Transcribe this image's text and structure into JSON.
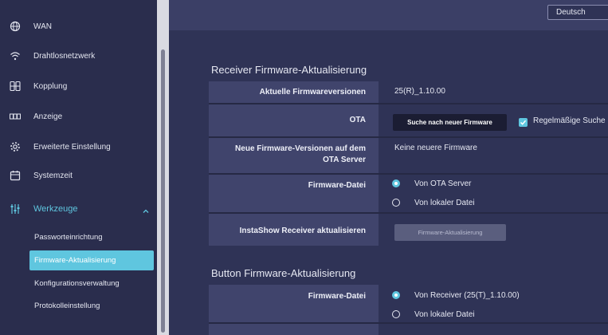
{
  "sidebar": {
    "items": [
      {
        "label": "WAN",
        "icon": "globe-icon"
      },
      {
        "label": "Drahtlosnetzwerk",
        "icon": "wifi-icon"
      },
      {
        "label": "Kopplung",
        "icon": "pairing-icon"
      },
      {
        "label": "Anzeige",
        "icon": "display-icon"
      },
      {
        "label": "Erweiterte Einstellung",
        "icon": "gear-icon"
      },
      {
        "label": "Systemzeit",
        "icon": "calendar-icon"
      },
      {
        "label": "Werkzeuge",
        "icon": "tools-icon"
      }
    ],
    "subitems": [
      {
        "label": "Passworteinrichtung"
      },
      {
        "label": "Firmware-Aktualisierung"
      },
      {
        "label": "Konfigurationsverwaltung"
      },
      {
        "label": "Protokolleinstellung"
      }
    ]
  },
  "header": {
    "language": "Deutsch"
  },
  "receiver": {
    "title": "Receiver Firmware-Aktualisierung",
    "current_label": "Aktuelle Firmwareversionen",
    "current_value": "25(R)_1.10.00",
    "ota_label": "OTA",
    "ota_button": "Suche nach neuer Firmware",
    "ota_checkbox": "Regelmäßige Suche",
    "new_label_line1": "Neue Firmware-Versionen auf dem",
    "new_label_line2": "OTA Server",
    "new_value": "Keine neuere Firmware",
    "file_label": "Firmware-Datei",
    "file_option1": "Von OTA Server",
    "file_option2": "Von lokaler Datei",
    "update_label": "InstaShow Receiver aktualisieren",
    "update_button": "Firmware-Aktualisierung"
  },
  "button_section": {
    "title": "Button Firmware-Aktualisierung",
    "file_label": "Firmware-Datei",
    "file_option1": "Von Receiver (25(T)_1.10.00)",
    "file_option2": "Von lokaler Datei"
  },
  "colors": {
    "accent": "#5fc6df",
    "sidebar_bg": "#2a2d4d",
    "main_bg": "#2f3356"
  }
}
